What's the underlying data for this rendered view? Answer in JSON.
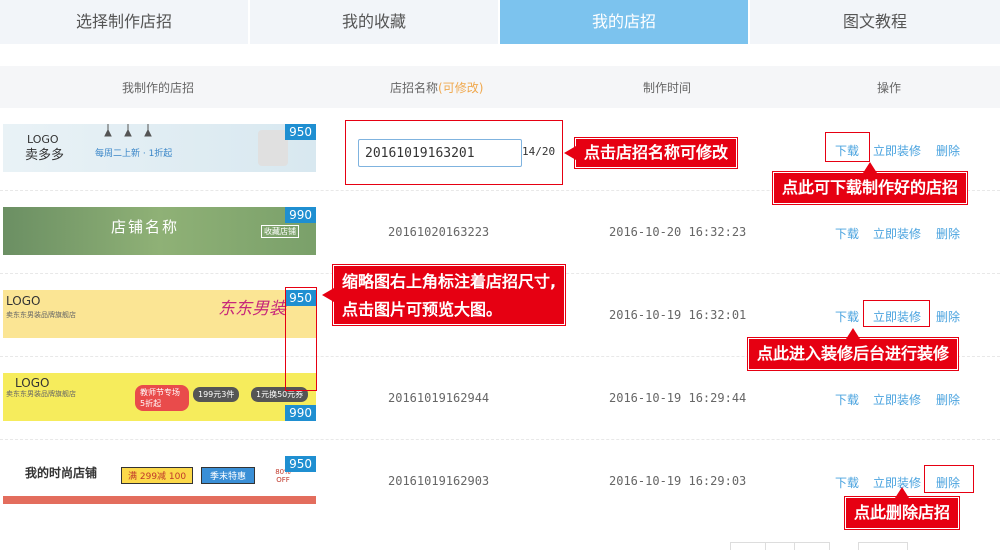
{
  "tabs": [
    {
      "label": "选择制作店招"
    },
    {
      "label": "我的收藏"
    },
    {
      "label": "我的店招"
    },
    {
      "label": "图文教程"
    }
  ],
  "active_tab": 2,
  "table": {
    "headers": {
      "thumbnail": "我制作的店招",
      "name": "店招名称",
      "name_hint": "(可修改)",
      "time": "制作时间",
      "actions": "操作"
    },
    "action_labels": {
      "download": "下载",
      "decorate": "立即装修",
      "delete": "删除"
    },
    "rows": [
      {
        "size": "950",
        "name": "20161019163201",
        "time": "",
        "thumb": {
          "logo": "LOGO",
          "shop": "卖多多",
          "promo": "每周二上新 · 1折起"
        }
      },
      {
        "size": "990",
        "name": "20161020163223",
        "time": "2016-10-20 16:32:23",
        "thumb": {
          "shop": "店铺名称",
          "btn": "收藏店铺"
        }
      },
      {
        "size": "950",
        "name": "",
        "time": "2016-10-19 16:32:01",
        "thumb": {
          "logo": "LOGO",
          "sub": "卖东东男装品牌旗舰店",
          "art": "东东男装"
        }
      },
      {
        "size": "990",
        "name": "20161019162944",
        "time": "2016-10-19 16:29:44",
        "thumb": {
          "logo": "LOGO",
          "sub": "卖东东男装品牌旗舰店",
          "p1": "教师节专场 5折起",
          "p2": "199元3件",
          "p3": "1元换50元券"
        }
      },
      {
        "size": "950",
        "name": "20161019162903",
        "time": "2016-10-19 16:29:03",
        "thumb": {
          "shop": "我的时尚店铺",
          "coupon": "满 299减 100",
          "sale": "季末特惠",
          "off": "80% OFF"
        }
      }
    ]
  },
  "edit": {
    "value": "20161019163201",
    "counter": "14/20"
  },
  "callouts": {
    "rename": "点击店招名称可修改",
    "download": "点此可下载制作好的店招",
    "size_note_line1": "缩略图右上角标注着店招尺寸,",
    "size_note_line2": "点击图片可预览大图。",
    "decorate": "点此进入装修后台进行装修",
    "delete": "点此删除店招"
  },
  "colors": {
    "active_tab": "#7cc3ee",
    "callout": "#e60012",
    "link": "#4aa3df",
    "badge": "#1f8fd1"
  }
}
